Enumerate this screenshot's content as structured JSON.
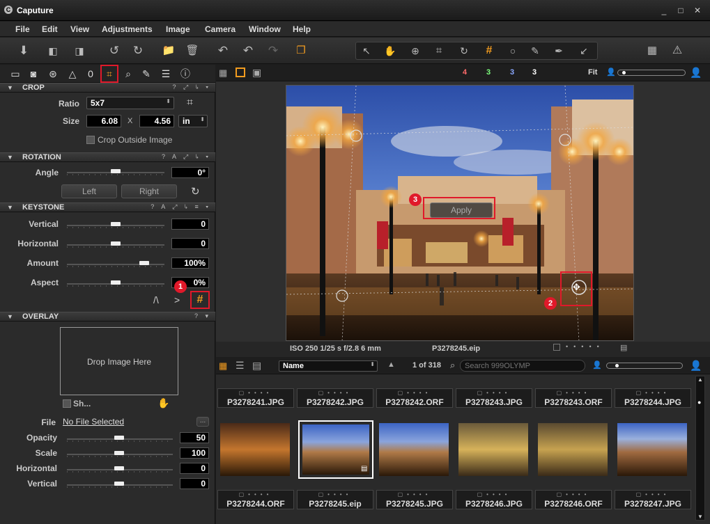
{
  "app": {
    "title": "Caputure"
  },
  "window": {
    "minimize": "_",
    "maximize": "□",
    "close": "✕"
  },
  "menu": [
    "File",
    "Edit",
    "View",
    "Adjustments",
    "Image",
    "Camera",
    "Window",
    "Help"
  ],
  "crop": {
    "title": "CROP",
    "ratio_label": "Ratio",
    "ratio_value": "5x7",
    "size_label": "Size",
    "width": "6.08",
    "x_label": "X",
    "height": "4.56",
    "unit": "in",
    "outside_label": "Crop Outside Image"
  },
  "rotation": {
    "title": "ROTATION",
    "angle_label": "Angle",
    "angle_value": "0°",
    "left_button": "Left",
    "right_button": "Right"
  },
  "keystone": {
    "title": "KEYSTONE",
    "vertical_label": "Vertical",
    "vertical_value": "0",
    "horizontal_label": "Horizontal",
    "horizontal_value": "0",
    "amount_label": "Amount",
    "amount_value": "100%",
    "aspect_label": "Aspect",
    "aspect_value": "0%",
    "badge": "1",
    "angle_glyph_a": "/\\",
    "angle_glyph_b": ">"
  },
  "overlay": {
    "title": "OVERLAY",
    "drop_text": "Drop Image Here",
    "show_label": "Sh...",
    "file_label": "File",
    "file_value": "No File Selected",
    "browse": "...",
    "opacity_label": "Opacity",
    "opacity_value": "50",
    "scale_label": "Scale",
    "scale_value": "100",
    "horizontal_label": "Horizontal",
    "horizontal_value": "0",
    "vertical_label": "Vertical",
    "vertical_value": "0"
  },
  "viewer": {
    "counts": [
      "4",
      "3",
      "3",
      "3"
    ],
    "count_colors": [
      "#ff6a6a",
      "#7cff7c",
      "#8aa8ff",
      "#ffffff"
    ],
    "fit_label": "Fit",
    "apply_label": "Apply",
    "badge2": "2",
    "badge3": "3",
    "info": "ISO 250  1/25 s  f/2.8  6 mm",
    "filename": "P3278245.eip"
  },
  "browser": {
    "sort_label": "Name",
    "count": "1 of 318",
    "search_placeholder": "Search 999OLYMP",
    "top_row": [
      "P3278241.JPG",
      "P3278242.JPG",
      "P3278242.ORF",
      "P3278243.JPG",
      "P3278243.ORF",
      "P3278244.JPG"
    ],
    "bottom_row": [
      "P3278244.ORF",
      "P3278245.eip",
      "P3278245.JPG",
      "P3278246.JPG",
      "P3278246.ORF",
      "P3278247.JPG"
    ]
  },
  "colors": {
    "accent": "#e0192a",
    "orange": "#f39c1f"
  }
}
